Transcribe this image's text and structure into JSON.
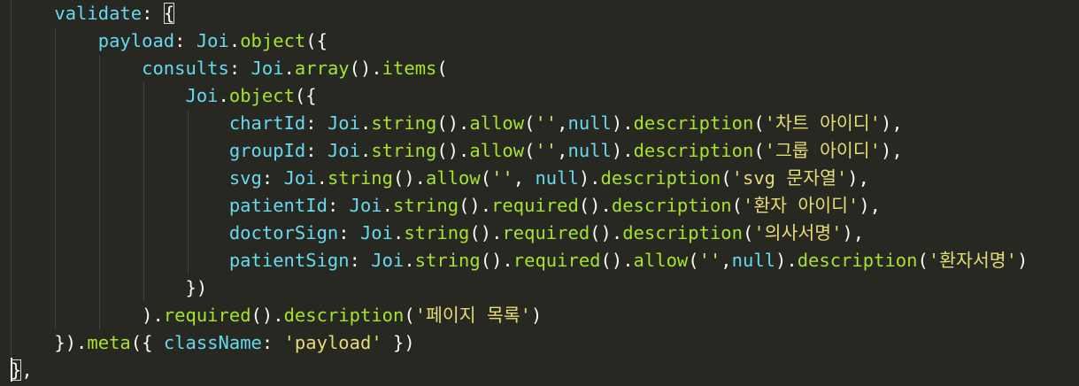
{
  "editor": {
    "lines": [
      [
        {
          "t": "    ",
          "c": "p"
        },
        {
          "t": "validate",
          "c": "k"
        },
        {
          "t": ": ",
          "c": "p"
        },
        {
          "t": "{",
          "c": "p",
          "bm": true
        }
      ],
      [
        {
          "t": "        ",
          "c": "p"
        },
        {
          "t": "payload",
          "c": "k"
        },
        {
          "t": ": ",
          "c": "p"
        },
        {
          "t": "Joi",
          "c": "k"
        },
        {
          "t": ".",
          "c": "p"
        },
        {
          "t": "object",
          "c": "f"
        },
        {
          "t": "({",
          "c": "p"
        }
      ],
      [
        {
          "t": "            ",
          "c": "p"
        },
        {
          "t": "consults",
          "c": "k"
        },
        {
          "t": ": ",
          "c": "p"
        },
        {
          "t": "Joi",
          "c": "k"
        },
        {
          "t": ".",
          "c": "p"
        },
        {
          "t": "array",
          "c": "f"
        },
        {
          "t": "().",
          "c": "p"
        },
        {
          "t": "items",
          "c": "f"
        },
        {
          "t": "(",
          "c": "p"
        }
      ],
      [
        {
          "t": "                ",
          "c": "p"
        },
        {
          "t": "Joi",
          "c": "k"
        },
        {
          "t": ".",
          "c": "p"
        },
        {
          "t": "object",
          "c": "f"
        },
        {
          "t": "({",
          "c": "p"
        }
      ],
      [
        {
          "t": "                    ",
          "c": "p"
        },
        {
          "t": "chartId",
          "c": "k"
        },
        {
          "t": ": ",
          "c": "p"
        },
        {
          "t": "Joi",
          "c": "k"
        },
        {
          "t": ".",
          "c": "p"
        },
        {
          "t": "string",
          "c": "f"
        },
        {
          "t": "().",
          "c": "p"
        },
        {
          "t": "allow",
          "c": "f"
        },
        {
          "t": "(",
          "c": "p"
        },
        {
          "t": "''",
          "c": "s"
        },
        {
          "t": ",",
          "c": "p"
        },
        {
          "t": "null",
          "c": "k"
        },
        {
          "t": ").",
          "c": "p"
        },
        {
          "t": "description",
          "c": "f"
        },
        {
          "t": "(",
          "c": "p"
        },
        {
          "t": "'차트 아이디'",
          "c": "s"
        },
        {
          "t": "),",
          "c": "p"
        }
      ],
      [
        {
          "t": "                    ",
          "c": "p"
        },
        {
          "t": "groupId",
          "c": "k"
        },
        {
          "t": ": ",
          "c": "p"
        },
        {
          "t": "Joi",
          "c": "k"
        },
        {
          "t": ".",
          "c": "p"
        },
        {
          "t": "string",
          "c": "f"
        },
        {
          "t": "().",
          "c": "p"
        },
        {
          "t": "allow",
          "c": "f"
        },
        {
          "t": "(",
          "c": "p"
        },
        {
          "t": "''",
          "c": "s"
        },
        {
          "t": ",",
          "c": "p"
        },
        {
          "t": "null",
          "c": "k"
        },
        {
          "t": ").",
          "c": "p"
        },
        {
          "t": "description",
          "c": "f"
        },
        {
          "t": "(",
          "c": "p"
        },
        {
          "t": "'그룹 아이디'",
          "c": "s"
        },
        {
          "t": "),",
          "c": "p"
        }
      ],
      [
        {
          "t": "                    ",
          "c": "p"
        },
        {
          "t": "svg",
          "c": "k"
        },
        {
          "t": ": ",
          "c": "p"
        },
        {
          "t": "Joi",
          "c": "k"
        },
        {
          "t": ".",
          "c": "p"
        },
        {
          "t": "string",
          "c": "f"
        },
        {
          "t": "().",
          "c": "p"
        },
        {
          "t": "allow",
          "c": "f"
        },
        {
          "t": "(",
          "c": "p"
        },
        {
          "t": "''",
          "c": "s"
        },
        {
          "t": ", ",
          "c": "p"
        },
        {
          "t": "null",
          "c": "k"
        },
        {
          "t": ").",
          "c": "p"
        },
        {
          "t": "description",
          "c": "f"
        },
        {
          "t": "(",
          "c": "p"
        },
        {
          "t": "'svg 문자열'",
          "c": "s"
        },
        {
          "t": "),",
          "c": "p"
        }
      ],
      [
        {
          "t": "                    ",
          "c": "p"
        },
        {
          "t": "patientId",
          "c": "k"
        },
        {
          "t": ": ",
          "c": "p"
        },
        {
          "t": "Joi",
          "c": "k"
        },
        {
          "t": ".",
          "c": "p"
        },
        {
          "t": "string",
          "c": "f"
        },
        {
          "t": "().",
          "c": "p"
        },
        {
          "t": "required",
          "c": "f"
        },
        {
          "t": "().",
          "c": "p"
        },
        {
          "t": "description",
          "c": "f"
        },
        {
          "t": "(",
          "c": "p"
        },
        {
          "t": "'환자 아이디'",
          "c": "s"
        },
        {
          "t": "),",
          "c": "p"
        }
      ],
      [
        {
          "t": "                    ",
          "c": "p"
        },
        {
          "t": "doctorSign",
          "c": "k"
        },
        {
          "t": ": ",
          "c": "p"
        },
        {
          "t": "Joi",
          "c": "k"
        },
        {
          "t": ".",
          "c": "p"
        },
        {
          "t": "string",
          "c": "f"
        },
        {
          "t": "().",
          "c": "p"
        },
        {
          "t": "required",
          "c": "f"
        },
        {
          "t": "().",
          "c": "p"
        },
        {
          "t": "description",
          "c": "f"
        },
        {
          "t": "(",
          "c": "p"
        },
        {
          "t": "'의사서명'",
          "c": "s"
        },
        {
          "t": "),",
          "c": "p"
        }
      ],
      [
        {
          "t": "                    ",
          "c": "p"
        },
        {
          "t": "patientSign",
          "c": "k"
        },
        {
          "t": ": ",
          "c": "p"
        },
        {
          "t": "Joi",
          "c": "k"
        },
        {
          "t": ".",
          "c": "p"
        },
        {
          "t": "string",
          "c": "f"
        },
        {
          "t": "().",
          "c": "p"
        },
        {
          "t": "required",
          "c": "f"
        },
        {
          "t": "().",
          "c": "p"
        },
        {
          "t": "allow",
          "c": "f"
        },
        {
          "t": "(",
          "c": "p"
        },
        {
          "t": "''",
          "c": "s"
        },
        {
          "t": ",",
          "c": "p"
        },
        {
          "t": "null",
          "c": "k"
        },
        {
          "t": ").",
          "c": "p"
        },
        {
          "t": "description",
          "c": "f"
        },
        {
          "t": "(",
          "c": "p"
        },
        {
          "t": "'환자서명'",
          "c": "s"
        },
        {
          "t": ")",
          "c": "p"
        }
      ],
      [
        {
          "t": "                ",
          "c": "p"
        },
        {
          "t": "})",
          "c": "p"
        }
      ],
      [
        {
          "t": "            ",
          "c": "p"
        },
        {
          "t": ").",
          "c": "p"
        },
        {
          "t": "required",
          "c": "f"
        },
        {
          "t": "().",
          "c": "p"
        },
        {
          "t": "description",
          "c": "f"
        },
        {
          "t": "(",
          "c": "p"
        },
        {
          "t": "'페이지 목록'",
          "c": "s"
        },
        {
          "t": ")",
          "c": "p"
        }
      ],
      [
        {
          "t": "    ",
          "c": "p"
        },
        {
          "t": "}).",
          "c": "p"
        },
        {
          "t": "meta",
          "c": "f"
        },
        {
          "t": "({ ",
          "c": "p"
        },
        {
          "t": "className",
          "c": "k"
        },
        {
          "t": ": ",
          "c": "p"
        },
        {
          "t": "'payload'",
          "c": "s"
        },
        {
          "t": " })",
          "c": "p"
        }
      ],
      [
        {
          "t": "}",
          "c": "p",
          "bm": true
        },
        {
          "t": ",",
          "c": "p"
        }
      ]
    ]
  }
}
